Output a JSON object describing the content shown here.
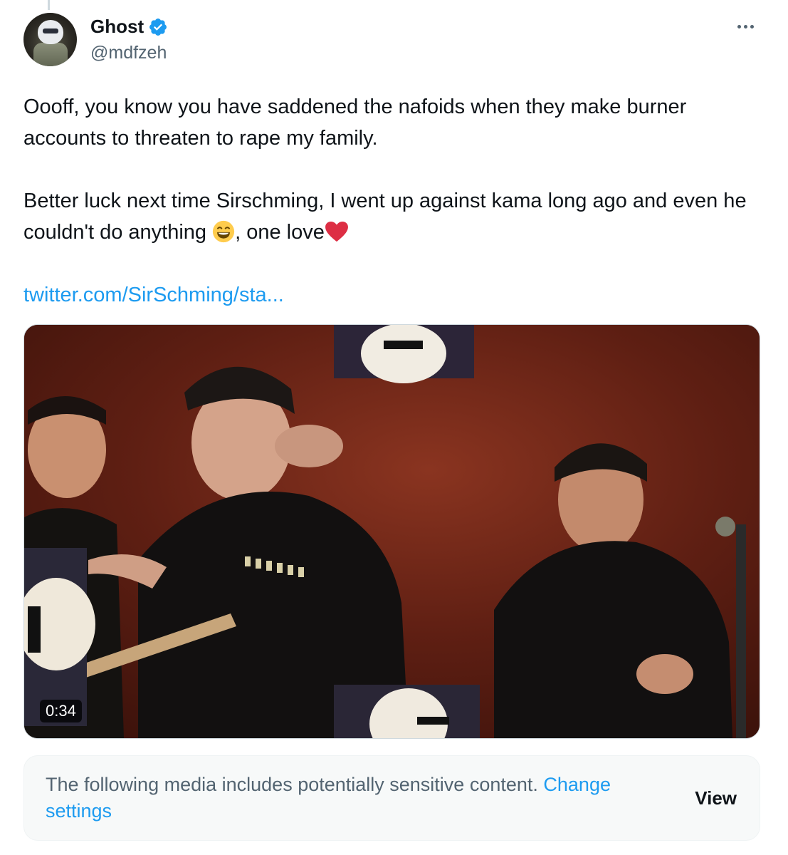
{
  "author": {
    "name": "Ghost",
    "handle": "@mdfzeh",
    "verified": true,
    "verified_color": "#1d9bf0"
  },
  "more_icon": "more-horizontal-icon",
  "tweet": {
    "paragraph1": "Oooff, you know you have saddened the nafoids when they make burner accounts to threaten to rape my family.",
    "paragraph2_before_emoji": "Better luck next time Sirschming, I went up against kama long ago and even he couldn't do anything ",
    "paragraph2_between": ", one love",
    "emoji1": "grinning-face-with-smiling-eyes-emoji",
    "emoji2": "red-heart-emoji",
    "link": "twitter.com/SirSchming/sta..."
  },
  "media": {
    "type": "video",
    "duration": "0:34"
  },
  "sensitive_notice": {
    "text": "The following media includes potentially sensitive content. ",
    "change_link": "Change settings",
    "view_button": "View"
  },
  "colors": {
    "link": "#1d9bf0",
    "secondary_text": "#536471",
    "primary_text": "#0f1419"
  }
}
